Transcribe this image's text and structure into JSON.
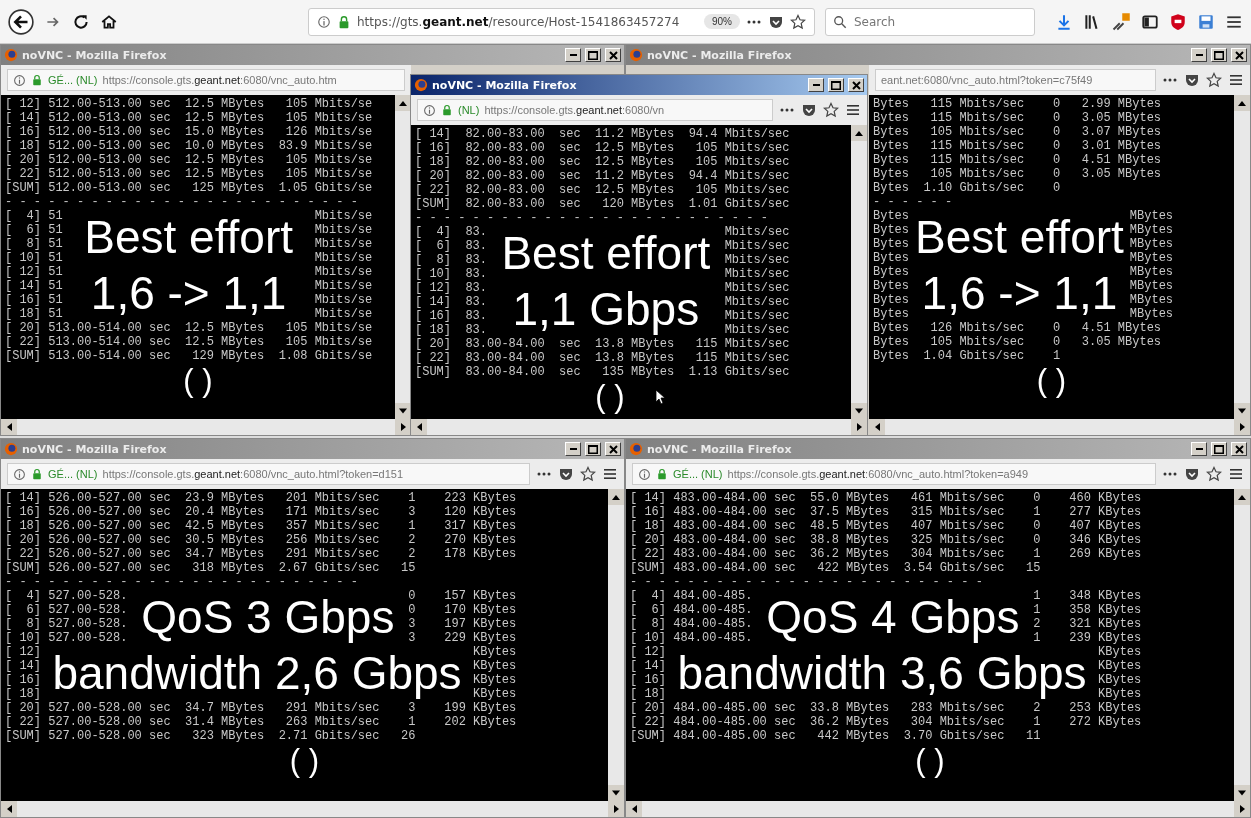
{
  "browser": {
    "url": "https://gts.**geant.net**/resource/Host-1541863457274",
    "zoom": "90%",
    "search": {
      "placeholder": "Search"
    }
  },
  "windows": [
    {
      "title": "noVNC - Mozilla Firefox",
      "active": false,
      "identity": "GÉ... (NL)",
      "url": "https://console.gts.**geant.net**:6080/vnc_auto.htm",
      "rows": [
        {
          "kind": "text",
          "text": "[ 12] 512.00-513.00 sec  12.5 MBytes   105 Mbits/se"
        },
        {
          "kind": "text",
          "text": "[ 14] 512.00-513.00 sec  12.5 MBytes   105 Mbits/se"
        },
        {
          "kind": "text",
          "text": "[ 16] 512.00-513.00 sec  15.0 MBytes   126 Mbits/se"
        },
        {
          "kind": "text",
          "text": "[ 18] 512.00-513.00 sec  10.0 MBytes  83.9 Mbits/se"
        },
        {
          "kind": "text",
          "text": "[ 20] 512.00-513.00 sec  12.5 MBytes   105 Mbits/se"
        },
        {
          "kind": "text",
          "text": "[ 22] 512.00-513.00 sec  12.5 MBytes   105 Mbits/se"
        },
        {
          "kind": "text",
          "text": "[SUM] 512.00-513.00 sec   125 MBytes  1.05 Gbits/se"
        },
        {
          "kind": "text",
          "text": "- - - - - - - - - - - - - - - - - - - - - - - - -"
        },
        {
          "kind": "band",
          "cells": [
            {
              "kind": "term",
              "lines": [
                "[  4] 51",
                "[  6] 51",
                "[  8] 51",
                "[ 10] 51"
              ]
            },
            {
              "kind": "caption",
              "text": "Best effort"
            },
            {
              "kind": "term",
              "lines": [
                "Mbits/se",
                "Mbits/se",
                "Mbits/se",
                "Mbits/se"
              ]
            }
          ]
        },
        {
          "kind": "band",
          "cells": [
            {
              "kind": "term",
              "lines": [
                "[ 12] 51",
                "[ 14] 51",
                "[ 16] 51",
                "[ 18] 51"
              ]
            },
            {
              "kind": "caption",
              "text": "1,6 -> 1,1"
            },
            {
              "kind": "term",
              "lines": [
                "Mbits/se",
                "Mbits/se",
                "Mbits/se",
                "Mbits/se"
              ]
            }
          ]
        },
        {
          "kind": "text",
          "text": "[ 20] 513.00-514.00 sec  12.5 MBytes   105 Mbits/se"
        },
        {
          "kind": "text",
          "text": "[ 22] 513.00-514.00 sec  12.5 MBytes   105 Mbits/se"
        },
        {
          "kind": "text",
          "text": "[SUM] 513.00-514.00 sec   129 MBytes  1.08 Gbits/se"
        }
      ],
      "parens": "( )"
    },
    {
      "title": "noVNC - Mozilla Firefox",
      "active": true,
      "identity": "(NL)",
      "url": "https://console.gts.**geant.net**:6080/vn",
      "rows": [
        {
          "kind": "text",
          "text": "[ 14]  82.00-83.00  sec  11.2 MBytes  94.4 Mbits/sec"
        },
        {
          "kind": "text",
          "text": "[ 16]  82.00-83.00  sec  12.5 MBytes   105 Mbits/sec"
        },
        {
          "kind": "text",
          "text": "[ 18]  82.00-83.00  sec  12.5 MBytes   105 Mbits/sec"
        },
        {
          "kind": "text",
          "text": "[ 20]  82.00-83.00  sec  11.2 MBytes  94.4 Mbits/sec"
        },
        {
          "kind": "text",
          "text": "[ 22]  82.00-83.00  sec  12.5 MBytes   105 Mbits/sec"
        },
        {
          "kind": "text",
          "text": "[SUM]  82.00-83.00  sec   120 MBytes  1.01 Gbits/sec"
        },
        {
          "kind": "text",
          "text": "- - - - - - - - - - - - - - - - - - - - - - - - -"
        },
        {
          "kind": "band",
          "cells": [
            {
              "kind": "term",
              "lines": [
                "[  4]  83.",
                "[  6]  83.",
                "[  8]  83.",
                "[ 10]  83."
              ]
            },
            {
              "kind": "caption",
              "text": "Best effort"
            },
            {
              "kind": "term",
              "lines": [
                "Mbits/sec",
                "Mbits/sec",
                "Mbits/sec",
                "Mbits/sec"
              ]
            }
          ]
        },
        {
          "kind": "band",
          "cells": [
            {
              "kind": "term",
              "lines": [
                "[ 12]  83.",
                "[ 14]  83.",
                "[ 16]  83.",
                "[ 18]  83."
              ]
            },
            {
              "kind": "caption",
              "text": "1,1 Gbps"
            },
            {
              "kind": "term",
              "lines": [
                "Mbits/sec",
                "Mbits/sec",
                "Mbits/sec",
                "Mbits/sec"
              ]
            }
          ]
        },
        {
          "kind": "text",
          "text": "[ 20]  83.00-84.00  sec  13.8 MBytes   115 Mbits/sec"
        },
        {
          "kind": "text",
          "text": "[ 22]  83.00-84.00  sec  13.8 MBytes   115 Mbits/sec"
        },
        {
          "kind": "text",
          "text": "[SUM]  83.00-84.00  sec   135 MBytes  1.13 Gbits/sec"
        }
      ],
      "parens": "( )"
    },
    {
      "title": "noVNC - Mozilla Firefox",
      "active": false,
      "url": "eant.net:6080/vnc_auto.html?token=c75f49",
      "rows": [
        {
          "kind": "text",
          "text": "Bytes   115 Mbits/sec    0   2.99 MBytes"
        },
        {
          "kind": "text",
          "text": "Bytes   115 Mbits/sec    0   3.05 MBytes"
        },
        {
          "kind": "text",
          "text": "Bytes   105 Mbits/sec    0   3.07 MBytes"
        },
        {
          "kind": "text",
          "text": "Bytes   115 Mbits/sec    0   3.01 MBytes"
        },
        {
          "kind": "text",
          "text": "Bytes   115 Mbits/sec    0   4.51 MBytes"
        },
        {
          "kind": "text",
          "text": "Bytes   105 Mbits/sec    0   3.05 MBytes"
        },
        {
          "kind": "text",
          "text": "Bytes  1.10 Gbits/sec    0"
        },
        {
          "kind": "text",
          "text": "- - - - - -"
        },
        {
          "kind": "band",
          "cells": [
            {
              "kind": "term",
              "lines": [
                "Bytes",
                "Bytes",
                "Bytes",
                "Bytes"
              ]
            },
            {
              "kind": "caption",
              "text": "Best effort"
            },
            {
              "kind": "term",
              "lines": [
                "MBytes",
                "MBytes",
                "MBytes",
                "MBytes"
              ]
            }
          ]
        },
        {
          "kind": "band",
          "cells": [
            {
              "kind": "term",
              "lines": [
                "Bytes",
                "Bytes",
                "Bytes",
                "Bytes"
              ]
            },
            {
              "kind": "caption",
              "text": "1,6 -> 1,1"
            },
            {
              "kind": "term",
              "lines": [
                "MBytes",
                "MBytes",
                "MBytes",
                "MBytes"
              ]
            }
          ]
        },
        {
          "kind": "text",
          "text": "Bytes   126 Mbits/sec    0   4.51 MBytes"
        },
        {
          "kind": "text",
          "text": "Bytes   105 Mbits/sec    0   3.05 MBytes"
        },
        {
          "kind": "text",
          "text": "Bytes  1.04 Gbits/sec    1"
        }
      ],
      "parens": "( )"
    },
    {
      "title": "noVNC - Mozilla Firefox",
      "active": false,
      "identity": "GÉ... (NL)",
      "url": "https://console.gts.**geant.net**:6080/vnc_auto.html?token=d151",
      "rows": [
        {
          "kind": "text",
          "text": "[ 14] 526.00-527.00 sec  23.9 MBytes   201 Mbits/sec    1    223 KBytes"
        },
        {
          "kind": "text",
          "text": "[ 16] 526.00-527.00 sec  20.4 MBytes   171 Mbits/sec    3    120 KBytes"
        },
        {
          "kind": "text",
          "text": "[ 18] 526.00-527.00 sec  42.5 MBytes   357 Mbits/sec    1    317 KBytes"
        },
        {
          "kind": "text",
          "text": "[ 20] 526.00-527.00 sec  30.5 MBytes   256 Mbits/sec    2    270 KBytes"
        },
        {
          "kind": "text",
          "text": "[ 22] 526.00-527.00 sec  34.7 MBytes   291 Mbits/sec    2    178 KBytes"
        },
        {
          "kind": "text",
          "text": "[SUM] 526.00-527.00 sec   318 MBytes  2.67 Gbits/sec   15"
        },
        {
          "kind": "text",
          "text": "- - - - - - - - - - - - - - - - - - - - - - - - -"
        },
        {
          "kind": "band",
          "cells": [
            {
              "kind": "term",
              "lines": [
                "[  4] 527.00-528.",
                "[  6] 527.00-528.",
                "[  8] 527.00-528.",
                "[ 10] 527.00-528."
              ]
            },
            {
              "kind": "caption",
              "text": "QoS 3 Gbps"
            },
            {
              "kind": "term",
              "lines": [
                "0    157 KBytes",
                "0    170 KBytes",
                "3    197 KBytes",
                "3    229 KBytes"
              ]
            }
          ]
        },
        {
          "kind": "band",
          "cells": [
            {
              "kind": "term",
              "lines": [
                "[ 12]",
                "[ 14]",
                "[ 16]",
                "[ 18]"
              ]
            },
            {
              "kind": "caption",
              "text": "bandwidth 2,6 Gbps"
            },
            {
              "kind": "term",
              "lines": [
                "KBytes",
                "KBytes",
                "KBytes",
                "KBytes"
              ]
            }
          ]
        },
        {
          "kind": "text",
          "text": "[ 20] 527.00-528.00 sec  34.7 MBytes   291 Mbits/sec    3    199 KBytes"
        },
        {
          "kind": "text",
          "text": "[ 22] 527.00-528.00 sec  31.4 MBytes   263 Mbits/sec    1    202 KBytes"
        },
        {
          "kind": "text",
          "text": "[SUM] 527.00-528.00 sec   323 MBytes  2.71 Gbits/sec   26"
        }
      ],
      "parens": "( )"
    },
    {
      "title": "noVNC - Mozilla Firefox",
      "active": false,
      "identity": "GÉ... (NL)",
      "url": "https://console.gts.**geant.net**:6080/vnc_auto.html?token=a949",
      "rows": [
        {
          "kind": "text",
          "text": "[ 14] 483.00-484.00 sec  55.0 MBytes   461 Mbits/sec    0    460 KBytes"
        },
        {
          "kind": "text",
          "text": "[ 16] 483.00-484.00 sec  37.5 MBytes   315 Mbits/sec    1    277 KBytes"
        },
        {
          "kind": "text",
          "text": "[ 18] 483.00-484.00 sec  48.5 MBytes   407 Mbits/sec    0    407 KBytes"
        },
        {
          "kind": "text",
          "text": "[ 20] 483.00-484.00 sec  38.8 MBytes   325 Mbits/sec    0    346 KBytes"
        },
        {
          "kind": "text",
          "text": "[ 22] 483.00-484.00 sec  36.2 MBytes   304 Mbits/sec    1    269 KBytes"
        },
        {
          "kind": "text",
          "text": "[SUM] 483.00-484.00 sec   422 MBytes  3.54 Gbits/sec   15"
        },
        {
          "kind": "text",
          "text": "- - - - - - - - - - - - - - - - - - - - - - - - -"
        },
        {
          "kind": "band",
          "cells": [
            {
              "kind": "term",
              "lines": [
                "[  4] 484.00-485.",
                "[  6] 484.00-485.",
                "[  8] 484.00-485.",
                "[ 10] 484.00-485."
              ]
            },
            {
              "kind": "caption",
              "text": "QoS 4 Gbps"
            },
            {
              "kind": "term",
              "lines": [
                "1    348 KBytes",
                "1    358 KBytes",
                "2    321 KBytes",
                "1    239 KBytes"
              ]
            }
          ]
        },
        {
          "kind": "band",
          "cells": [
            {
              "kind": "term",
              "lines": [
                "[ 12]",
                "[ 14]",
                "[ 16]",
                "[ 18]"
              ]
            },
            {
              "kind": "caption",
              "text": "bandwidth 3,6 Gbps"
            },
            {
              "kind": "term",
              "lines": [
                "KBytes",
                "KBytes",
                "KBytes",
                "KBytes"
              ]
            }
          ]
        },
        {
          "kind": "text",
          "text": "[ 20] 484.00-485.00 sec  33.8 MBytes   283 Mbits/sec    2    253 KBytes"
        },
        {
          "kind": "text",
          "text": "[ 22] 484.00-485.00 sec  36.2 MBytes   304 Mbits/sec    1    272 KBytes"
        },
        {
          "kind": "text",
          "text": "[SUM] 484.00-485.00 sec   442 MBytes  3.70 Gbits/sec   11"
        }
      ],
      "parens": "( )"
    }
  ]
}
